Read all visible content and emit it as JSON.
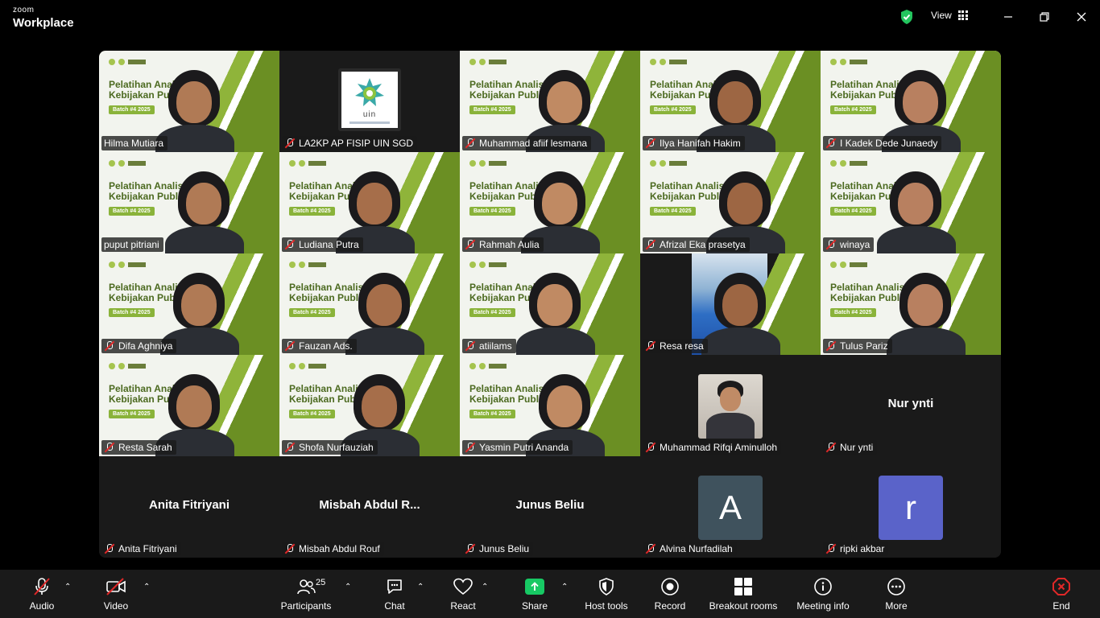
{
  "titlebar": {
    "brand_top": "zoom",
    "brand_bottom": "Workplace",
    "view_label": "View"
  },
  "tiles": [
    {
      "name": "Hilma Mutiara",
      "kind": "video",
      "mic_off": false
    },
    {
      "name": "LA2KP AP FISIP UIN SGD",
      "kind": "logo",
      "mic_off": true
    },
    {
      "name": "Muhammad afiif lesmana",
      "kind": "video",
      "mic_off": true
    },
    {
      "name": "Ilya Hanifah Hakim",
      "kind": "video",
      "mic_off": true
    },
    {
      "name": "I Kadek Dede Junaedy",
      "kind": "video",
      "mic_off": true
    },
    {
      "name": "puput pitriani",
      "kind": "video",
      "mic_off": false,
      "active": true
    },
    {
      "name": "Ludiana Putra",
      "kind": "video",
      "mic_off": true
    },
    {
      "name": "Rahmah Aulia",
      "kind": "video",
      "mic_off": true
    },
    {
      "name": "Afrizal Eka prasetya",
      "kind": "video",
      "mic_off": true
    },
    {
      "name": "winaya",
      "kind": "video",
      "mic_off": true
    },
    {
      "name": "Difa Aghniya",
      "kind": "video",
      "mic_off": true
    },
    {
      "name": "Fauzan Ads.",
      "kind": "video",
      "mic_off": true
    },
    {
      "name": "atiilams",
      "kind": "video",
      "mic_off": true
    },
    {
      "name": "Resa resa",
      "kind": "video",
      "mic_off": true
    },
    {
      "name": "Tulus Pariz",
      "kind": "video",
      "mic_off": true
    },
    {
      "name": "Resta Sarah",
      "kind": "video",
      "mic_off": true
    },
    {
      "name": "Shofa Nurfauziah",
      "kind": "video",
      "mic_off": true
    },
    {
      "name": "Yasmin Putri Ananda",
      "kind": "video",
      "mic_off": true
    },
    {
      "name": "Muhammad Rifqi Aminulloh",
      "kind": "photo",
      "mic_off": true
    },
    {
      "name": "Nur ynti",
      "kind": "text",
      "display": "Nur ynti",
      "mic_off": true
    },
    {
      "name": "Anita Fitriyani",
      "kind": "text",
      "display": "Anita Fitriyani",
      "mic_off": true
    },
    {
      "name": "Misbah Abdul Rouf",
      "kind": "text",
      "display": "Misbah  Abdul  R...",
      "mic_off": true
    },
    {
      "name": "Junus Beliu",
      "kind": "text",
      "display": "Junus Beliu",
      "mic_off": true
    },
    {
      "name": "Alvina Nurfadilah",
      "kind": "avatar",
      "letter": "A",
      "color": "#3f525d",
      "mic_off": true
    },
    {
      "name": "ripki akbar",
      "kind": "avatar",
      "letter": "r",
      "color": "#5a63c9",
      "mic_off": true
    }
  ],
  "slide": {
    "title": "Pelatihan Analis\nKebijakan Publik",
    "batch": "Batch #4 2025"
  },
  "logo": {
    "text": "uin"
  },
  "toolbar": {
    "audio": "Audio",
    "video": "Video",
    "participants": "Participants",
    "participants_count": "25",
    "chat": "Chat",
    "react": "React",
    "share": "Share",
    "host_tools": "Host tools",
    "record": "Record",
    "breakout": "Breakout rooms",
    "meeting_info": "Meeting info",
    "more": "More",
    "end": "End"
  },
  "colors": {
    "accent_active": "#23d9a5",
    "share": "#17c964",
    "end": "#e02828",
    "mic_off": "#e02828"
  }
}
